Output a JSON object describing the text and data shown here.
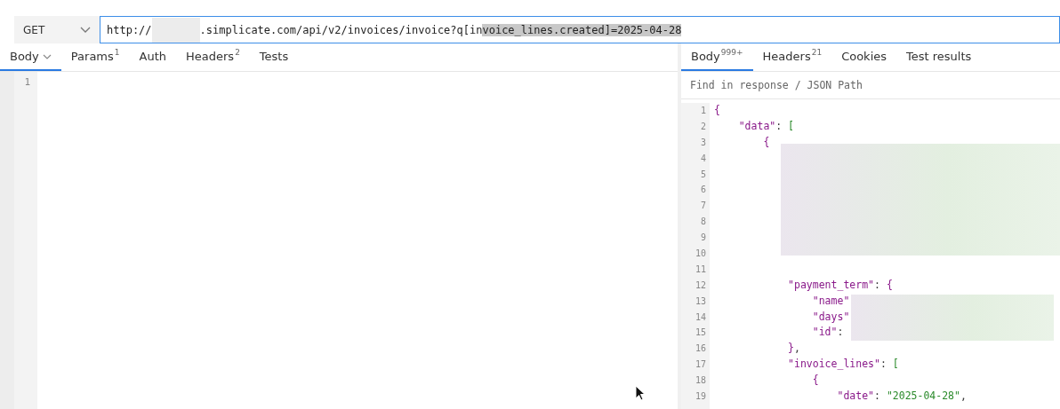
{
  "request": {
    "method": "GET",
    "url": {
      "prefix": "http://",
      "rest": ".simplicate.com/api/v2/invoices/invoice?q[in",
      "selected": "voice_lines.created]=2025-04-28"
    }
  },
  "request_tabs": [
    {
      "label": "Body",
      "has_menu": true,
      "selected": true
    },
    {
      "label": "Params",
      "count": "1",
      "has_menu": false,
      "selected": false
    },
    {
      "label": "Auth",
      "has_menu": false,
      "selected": false
    },
    {
      "label": "Headers",
      "count": "2",
      "has_menu": false,
      "selected": false
    },
    {
      "label": "Tests",
      "has_menu": false,
      "selected": false
    }
  ],
  "request_body": {
    "line_numbers": [
      "1"
    ]
  },
  "response_tabs": [
    {
      "label": "Body",
      "count": "999+",
      "selected": true
    },
    {
      "label": "Headers",
      "count": "21",
      "selected": false
    },
    {
      "label": "Cookies",
      "selected": false
    },
    {
      "label": "Test results",
      "selected": false
    }
  ],
  "response_search": {
    "placeholder": "Find in response / JSON Path"
  },
  "response_lines": [
    {
      "n": "1",
      "tokens": [
        {
          "kind": "brace",
          "text": "{"
        }
      ]
    },
    {
      "n": "2",
      "tokens": [
        {
          "kind": "key",
          "text": "    \"data\""
        },
        {
          "kind": "punct",
          "text": ": "
        },
        {
          "kind": "bracket",
          "text": "["
        }
      ]
    },
    {
      "n": "3",
      "tokens": [
        {
          "kind": "brace",
          "text": "        {"
        }
      ]
    },
    {
      "n": "4"
    },
    {
      "n": "5"
    },
    {
      "n": "6"
    },
    {
      "n": "7"
    },
    {
      "n": "8"
    },
    {
      "n": "9"
    },
    {
      "n": "10"
    },
    {
      "n": "11"
    },
    {
      "n": "12",
      "tokens": [
        {
          "kind": "key",
          "text": "            \"payment_term\""
        },
        {
          "kind": "punct",
          "text": ": "
        },
        {
          "kind": "brace",
          "text": "{"
        }
      ]
    },
    {
      "n": "13",
      "tokens": [
        {
          "kind": "key",
          "text": "                \"name\""
        }
      ]
    },
    {
      "n": "14",
      "tokens": [
        {
          "kind": "key",
          "text": "                \"days\""
        }
      ]
    },
    {
      "n": "15",
      "tokens": [
        {
          "kind": "key",
          "text": "                \"id\""
        },
        {
          "kind": "punct",
          "text": ": "
        }
      ]
    },
    {
      "n": "16",
      "tokens": [
        {
          "kind": "brace",
          "text": "            }"
        },
        {
          "kind": "punct",
          "text": ","
        }
      ]
    },
    {
      "n": "17",
      "tokens": [
        {
          "kind": "key",
          "text": "            \"invoice_lines\""
        },
        {
          "kind": "punct",
          "text": ": "
        },
        {
          "kind": "bracket",
          "text": "["
        }
      ]
    },
    {
      "n": "18",
      "tokens": [
        {
          "kind": "brace",
          "text": "                {"
        }
      ]
    },
    {
      "n": "19",
      "tokens": [
        {
          "kind": "key",
          "text": "                    \"date\""
        },
        {
          "kind": "punct",
          "text": ": "
        },
        {
          "kind": "string",
          "text": "\"2025-04-28\""
        },
        {
          "kind": "punct",
          "text": ","
        }
      ]
    }
  ]
}
